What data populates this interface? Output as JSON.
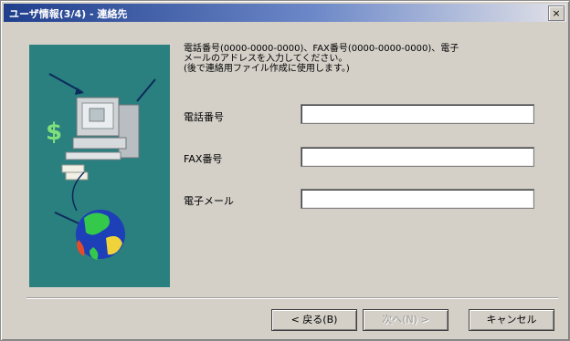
{
  "window": {
    "title": "ユーザ情報(3/4) - 連絡先",
    "close_glyph": "×"
  },
  "description": {
    "line1": "電話番号(0000-0000-0000)、FAX番号(0000-0000-0000)、電子",
    "line2": "メールのアドレスを入力してください。",
    "line3": "(後で連絡用ファイル作成に使用します。)"
  },
  "fields": {
    "phone_label": "電話番号",
    "phone_value": "",
    "fax_label": "FAX番号",
    "fax_value": "",
    "email_label": "電子メール",
    "email_value": ""
  },
  "buttons": {
    "back_label": "< 戻る(B)",
    "next_label": "次へ(N) >",
    "cancel_label": "キャンセル"
  },
  "colors": {
    "art_background": "#2a7f7f",
    "title_gradient_start": "#1f3e8c"
  }
}
